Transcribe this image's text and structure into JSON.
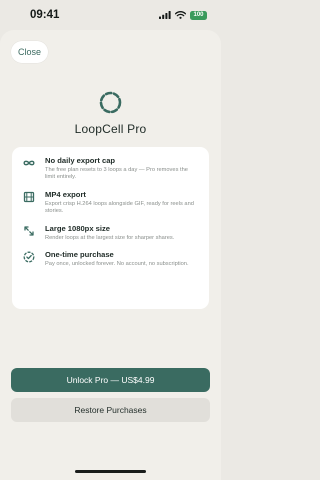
{
  "status_bar": {
    "time": "09:41",
    "battery_level": "100",
    "icons": [
      "signal-icon",
      "wifi-icon",
      "battery-icon"
    ]
  },
  "header": {
    "close_label": "Close"
  },
  "app": {
    "title": "LoopCell Pro",
    "logo_icon": "dashed-ring-icon"
  },
  "features": [
    {
      "icon": "infinity-icon",
      "title": "No daily export cap",
      "description": "The free plan resets to 3 loops a day — Pro removes the limit entirely."
    },
    {
      "icon": "film-icon",
      "title": "MP4 export",
      "description": "Export crisp H.264 loops alongside GIF, ready for reels and stories."
    },
    {
      "icon": "expand-icon",
      "title": "Large 1080px size",
      "description": "Render loops at the largest size for sharper shares."
    },
    {
      "icon": "check-badge-icon",
      "title": "One-time purchase",
      "description": "Pay once, unlocked forever. No account, no subscription."
    }
  ],
  "actions": {
    "unlock_label": "Unlock Pro — US$4.99",
    "restore_label": "Restore Purchases"
  },
  "colors": {
    "accent": "#3a6b61",
    "background": "#f1efea",
    "card": "#ffffff",
    "battery": "#3a9a5c"
  }
}
